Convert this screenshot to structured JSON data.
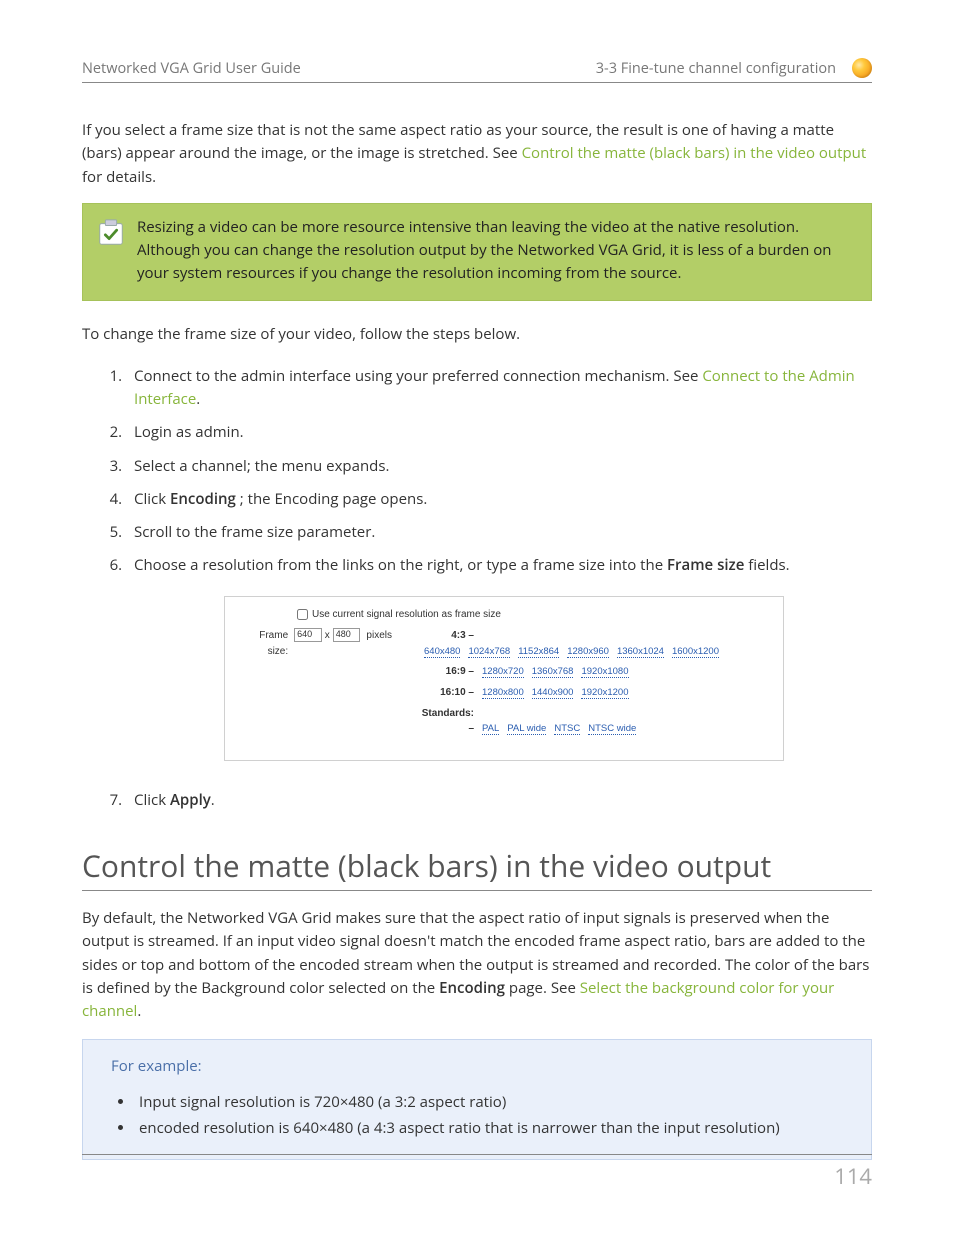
{
  "header": {
    "left": "Networked VGA Grid User Guide",
    "right": "3-3 Fine-tune channel configuration"
  },
  "intro": {
    "pre": "If you select a frame size that is not the same aspect ratio as your source, the result is one of having a matte (bars) appear around the image, or the image is stretched. See ",
    "link": "Control the matte (black bars) in the video output",
    "post": " for details."
  },
  "callout": "Resizing a video can be more resource intensive than leaving the video at the native resolution. Although you can change the resolution output by the Networked VGA Grid, it is less of a burden on your system resources if you change the resolution incoming from the source.",
  "lead": "To change the frame size of your video, follow the steps below.",
  "steps": {
    "s1_pre": "Connect to the admin interface using your preferred connection mechanism. See ",
    "s1_link": "Connect to the Admin Interface",
    "s1_post": ".",
    "s2": "Login as admin.",
    "s3": "Select a channel; the menu expands.",
    "s4_a": "Click ",
    "s4_b": "Encoding",
    "s4_c": " ; the Encoding  page opens.",
    "s5": "Scroll to the frame size parameter.",
    "s6_a": "Choose a resolution from the links on the right, or type a frame size into the ",
    "s6_b": "Frame size",
    "s6_c": " fields.",
    "s7_a": "Click ",
    "s7_b": "Apply",
    "s7_c": "."
  },
  "screenshot": {
    "checkbox_label": "Use current signal resolution as frame size",
    "frame_label": "Frame size:",
    "w": "640",
    "x": "x",
    "h": "480",
    "px": "pixels",
    "rows": [
      {
        "ratio": "4:3 –",
        "res": [
          "640x480",
          "1024x768",
          "1152x864",
          "1280x960",
          "1360x1024",
          "1600x1200"
        ]
      },
      {
        "ratio": "16:9 –",
        "res": [
          "1280x720",
          "1360x768",
          "1920x1080"
        ]
      },
      {
        "ratio": "16:10 –",
        "res": [
          "1280x800",
          "1440x900",
          "1920x1200"
        ]
      },
      {
        "ratio": "Standards: –",
        "res": [
          "PAL",
          "PAL wide",
          "NTSC",
          "NTSC wide"
        ]
      }
    ]
  },
  "section_heading": "Control the matte (black bars) in the video output",
  "section_para": {
    "a": "By default, the Networked VGA Grid makes sure that the aspect ratio of input signals is preserved when the output is streamed. If an input video signal doesn't match the encoded frame aspect ratio, bars are added to the sides or top and bottom of the encoded stream when the output is streamed and recorded. The color of the bars is defined by the Background color selected on the ",
    "b": "Encoding",
    "c": " page. See ",
    "link": "Select the background color for your channel",
    "d": "."
  },
  "example": {
    "title": "For example:",
    "items": [
      "Input signal resolution is 720×480 (a 3:2 aspect ratio)",
      "encoded resolution is 640×480 (a 4:3 aspect ratio that is narrower than the input resolution)"
    ]
  },
  "page_number": "114"
}
